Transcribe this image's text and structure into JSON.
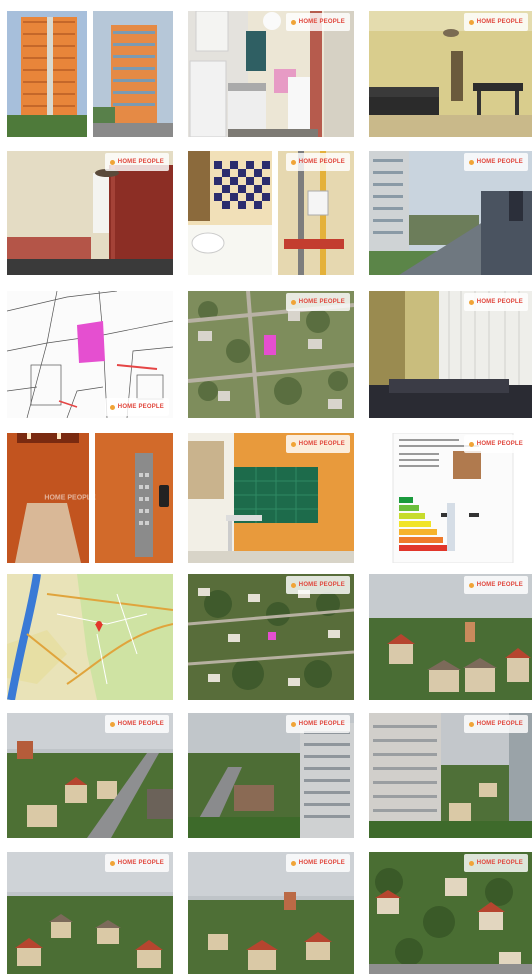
{
  "gallery": {
    "watermark": "HOME PEOPLE",
    "photos": [
      {
        "label": "building-exterior"
      },
      {
        "label": "kitchen"
      },
      {
        "label": "living-room"
      },
      {
        "label": "bedroom"
      },
      {
        "label": "bathroom"
      },
      {
        "label": "balcony"
      },
      {
        "label": "cadastral-map"
      },
      {
        "label": "aerial-view"
      },
      {
        "label": "room-curtains"
      },
      {
        "label": "elevator"
      },
      {
        "label": "mailboxes"
      },
      {
        "label": "energy-certificate"
      },
      {
        "label": "location-map"
      },
      {
        "label": "aerial-view-2"
      },
      {
        "label": "view-houses"
      },
      {
        "label": "view-street"
      },
      {
        "label": "view-tower"
      },
      {
        "label": "view-tower-2"
      },
      {
        "label": "view-panorama"
      },
      {
        "label": "view-panorama-2"
      },
      {
        "label": "view-garden-houses"
      }
    ]
  },
  "colors": {
    "watermark_accent": "#e0463c",
    "building_orange": "#e8853a",
    "map_pink": "#e54fd0"
  }
}
